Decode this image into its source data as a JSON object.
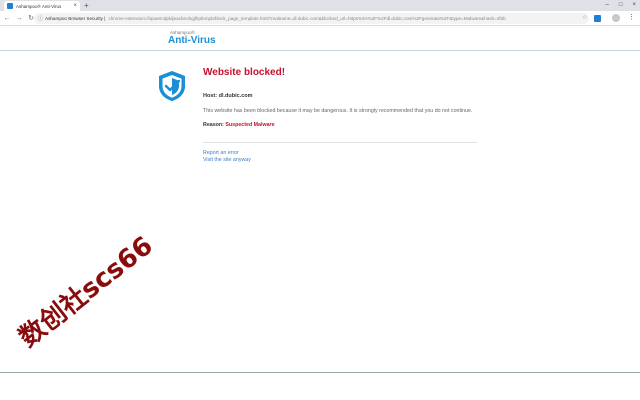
{
  "browser": {
    "tab_title": "Ashampoo® Anti-Virus",
    "tab_close": "×",
    "new_tab": "+",
    "window_controls": [
      "–",
      "□",
      "×"
    ],
    "omnibox_site": "Ashampoo Browser Security |",
    "omnibox_url": "chrome-extension://iqoaemdpldjeacbeohgjlhpbnnpb/block_page_template.html?realname=dl.dubic.com&blocked_url=https%3A%2F%2Fdl.dubic.com%2Fgenerate%2F&type=Malware&hash=4f2b",
    "icons": {
      "back": "back-arrow-icon",
      "forward": "forward-arrow-icon",
      "reload": "reload-icon",
      "star": "star-icon",
      "menu": "kebab-menu-icon"
    }
  },
  "brand": {
    "small": "Ashampoo®",
    "big": "Anti-Virus",
    "color": "#1b8fd6"
  },
  "block": {
    "heading": "Website blocked!",
    "host_label": "Host:",
    "host_value": "dl.dubic.com",
    "description": "This website has been blocked because it may be dangerous. It is strongly recommended that you do not continue.",
    "reason_label": "Reason:",
    "reason_value": "Suspected Malware",
    "report_link": "Report an error",
    "visit_link": "Visit the site anyway",
    "accent": "#c8102e"
  },
  "watermark": "数创社scs66"
}
